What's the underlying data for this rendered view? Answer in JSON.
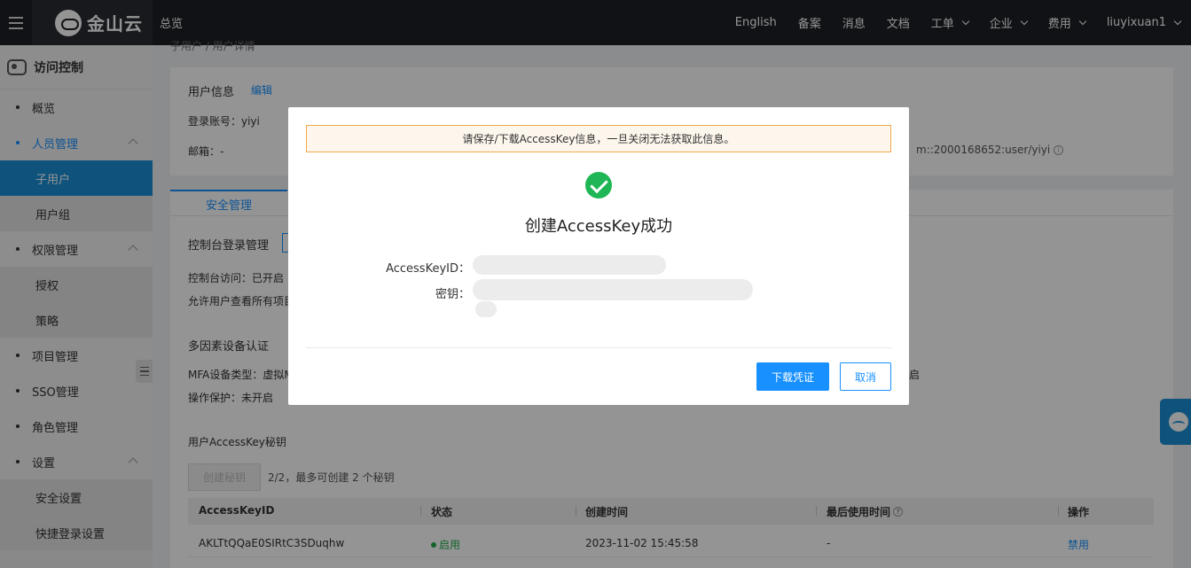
{
  "topbar": {
    "logo_text": "金山云",
    "overview": "总览",
    "items": [
      {
        "label": "English",
        "dropdown": false
      },
      {
        "label": "备案",
        "dropdown": false
      },
      {
        "label": "消息",
        "dropdown": false
      },
      {
        "label": "文档",
        "dropdown": false
      },
      {
        "label": "工单",
        "dropdown": true
      },
      {
        "label": "企业",
        "dropdown": true
      },
      {
        "label": "费用",
        "dropdown": true
      },
      {
        "label": "liuyixuan1",
        "dropdown": true
      }
    ]
  },
  "sidebar": {
    "title": "访问控制",
    "overview": "概览",
    "people": "人员管理",
    "sub_users": "子用户",
    "user_groups": "用户组",
    "perm": "权限管理",
    "authorize": "授权",
    "policy": "策略",
    "project": "项目管理",
    "sso": "SSO管理",
    "role": "角色管理",
    "settings": "设置",
    "security_settings": "安全设置",
    "quick_login": "快捷登录设置"
  },
  "breadcrumb": "子用户 / 用户详情",
  "user_info": {
    "title": "用户信息",
    "edit": "编辑",
    "login_account": "登录账号：yiyi",
    "email": "邮箱：-",
    "trn": "m::2000168652:user/yiyi"
  },
  "security": {
    "tab": "安全管理",
    "console_login": "控制台登录管理",
    "console_access": "控制台访问：已开启",
    "allow_view": "允许用户查看所有项目",
    "mfa_title": "多因素设备认证",
    "mfa_type": "MFA设备类型：虚拟M",
    "op_protect": "操作保护：未开启",
    "right_open": "启",
    "ak_title": "用户AccessKey秘钥",
    "create_btn": "创建秘钥",
    "key_hint": "2/2，最多可创建 2 个秘钥"
  },
  "table": {
    "headers": {
      "id": "AccessKeyID",
      "status": "状态",
      "created": "创建时间",
      "last_used": "最后使用时间",
      "action": "操作"
    },
    "rows": [
      {
        "id": "AKLTtQQaE0SIRtC3SDuqhw",
        "status": "启用",
        "created": "2023-11-02 15:45:58",
        "last_used": "-",
        "action": "禁用"
      }
    ]
  },
  "modal": {
    "warning": "请保存/下载AccessKey信息，一旦关闭无法获取此信息。",
    "title": "创建AccessKey成功",
    "ak_label": "AccessKeyID：",
    "secret_label": "密钥：",
    "download": "下载凭证",
    "cancel": "取消"
  }
}
